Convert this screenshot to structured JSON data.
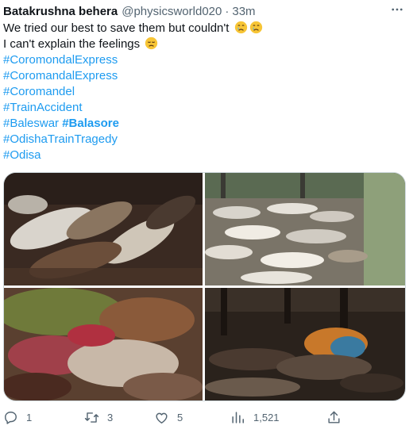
{
  "header": {
    "display_name": "Batakrushna behera",
    "handle": "@physicsworld020",
    "separator": "·",
    "time": "33m",
    "more_icon": "more-horizontal-icon"
  },
  "tweet": {
    "line1": "We tried our best to save them but couldn't",
    "line2": "I can't explain the feelings",
    "emojis": [
      "crying-face",
      "crying-face",
      "disappointed-face"
    ],
    "hashtags": [
      "#CoromondalExpress",
      "#CoromandalExpress",
      "#Coromandel",
      "#TrainAccident",
      "#Baleswar",
      "#Balasore",
      "#OdishaTrainTragedy",
      "#Odisa"
    ]
  },
  "media": {
    "photo_count": 4,
    "icon": "photo-icon"
  },
  "actions": {
    "reply": {
      "icon": "reply-icon",
      "count": "1"
    },
    "retweet": {
      "icon": "retweet-icon",
      "count": "3"
    },
    "like": {
      "icon": "heart-icon",
      "count": "5"
    },
    "views": {
      "icon": "views-chart-icon",
      "count": "1,521"
    },
    "share": {
      "icon": "share-icon"
    }
  },
  "colors": {
    "text": "#0f1419",
    "secondary": "#536471",
    "link": "#1d9bf0",
    "border": "#cfd9de"
  }
}
